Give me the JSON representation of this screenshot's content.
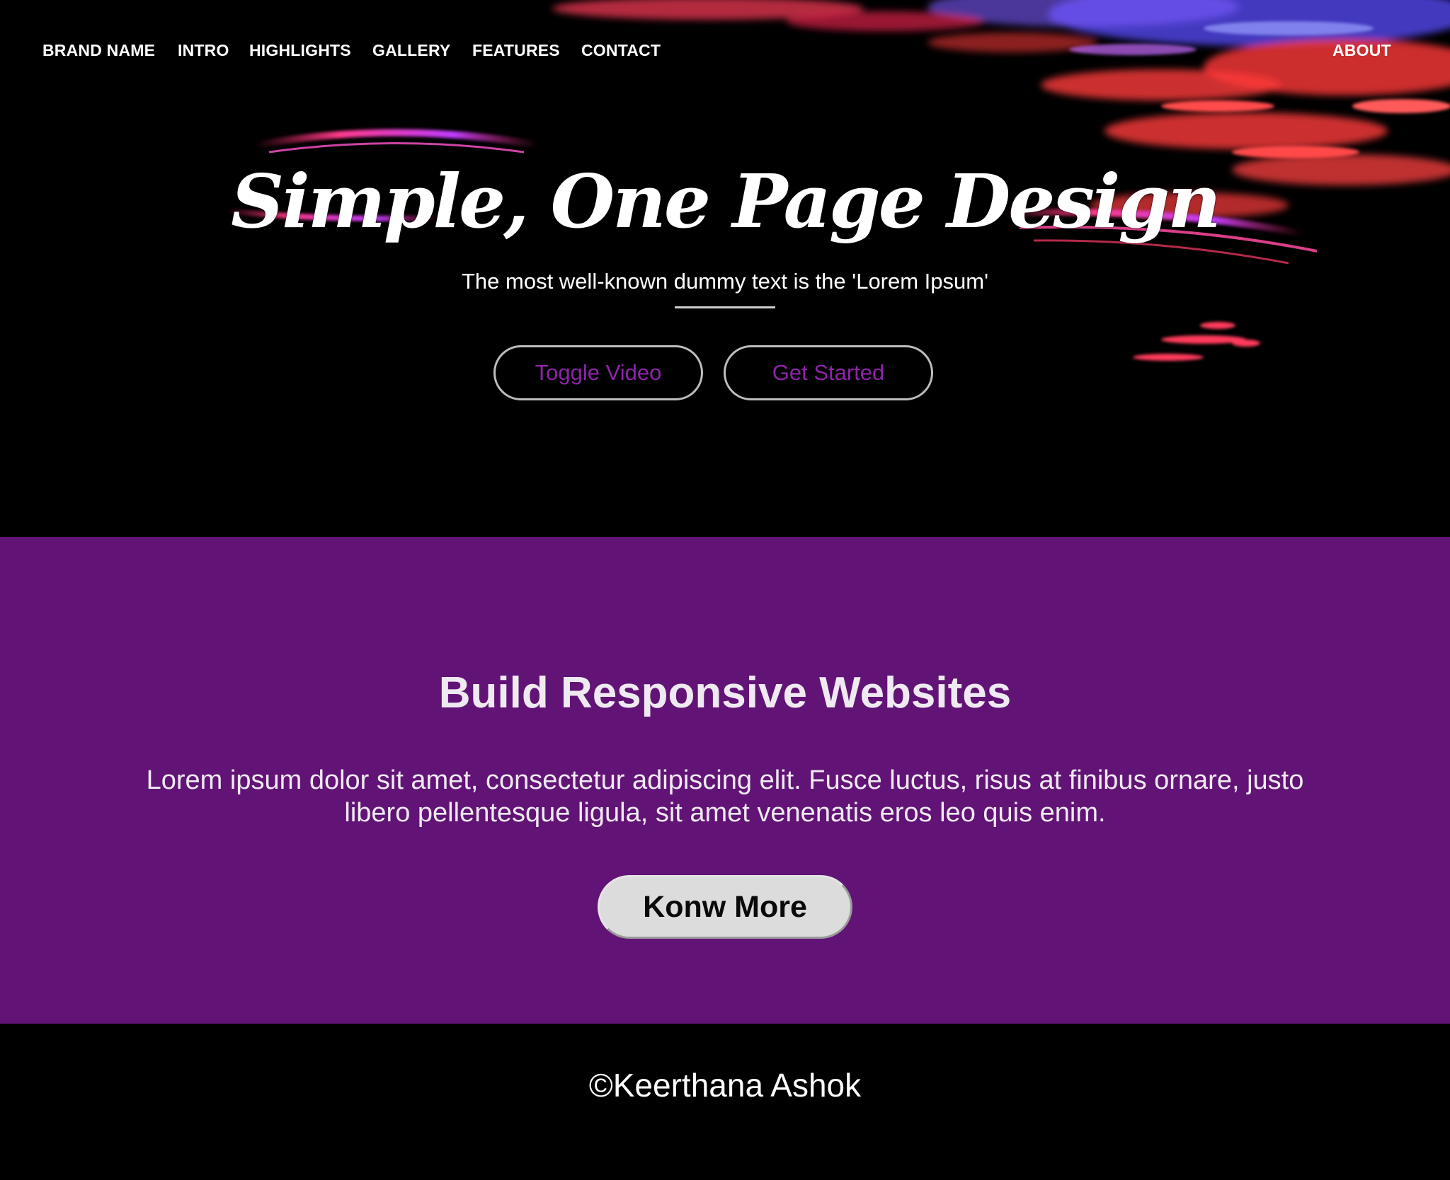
{
  "nav": {
    "brand": "BRAND NAME",
    "items": [
      "INTRO",
      "HIGHLIGHTS",
      "GALLERY",
      "FEATURES",
      "CONTACT"
    ],
    "right_item": "ABOUT"
  },
  "hero": {
    "title": "Simple, One Page Design",
    "subtitle": "The most well-known dummy text is the 'Lorem Ipsum'",
    "buttons": [
      "Toggle Video",
      "Get Started"
    ],
    "background": "abstract-light-streaks-image"
  },
  "section": {
    "title": "Build Responsive Websites",
    "text": "Lorem ipsum dolor sit amet, consectetur adipiscing elit. Fusce luctus, risus at finibus ornare, justo libero pellentesque ligula, sit amet venenatis eros leo quis enim.",
    "button": "Konw More"
  },
  "footer": {
    "text": "©Keerthana Ashok"
  },
  "colors": {
    "accent_purple": "#621476",
    "button_text_purple": "#8e24aa",
    "hero_background": "#000000"
  }
}
